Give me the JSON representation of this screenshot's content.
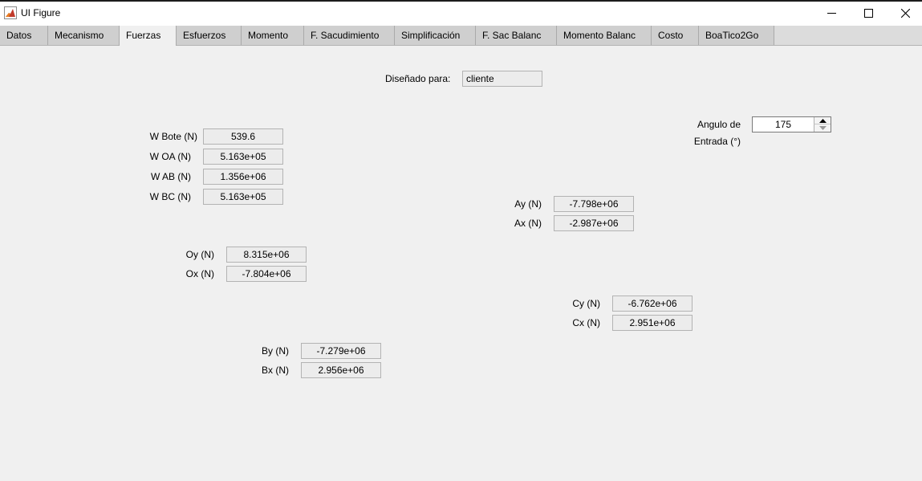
{
  "window": {
    "title": "UI Figure",
    "icon": "matlab-icon",
    "controls": [
      "minimize-icon",
      "maximize-icon",
      "close-icon"
    ]
  },
  "tabs": [
    {
      "label": "Datos"
    },
    {
      "label": "Mecanismo"
    },
    {
      "label": "Fuerzas",
      "active": true
    },
    {
      "label": "Esfuerzos"
    },
    {
      "label": "Momento"
    },
    {
      "label": "F. Sacudimiento"
    },
    {
      "label": "Simplificación"
    },
    {
      "label": "F. Sac Balanc"
    },
    {
      "label": "Momento Balanc"
    },
    {
      "label": "Costo"
    },
    {
      "label": "BoaTico2Go"
    }
  ],
  "designed_for": {
    "label": "Diseñado para:",
    "value": "cliente"
  },
  "entry_angle": {
    "label_line1": "Angulo de",
    "label_line2": "Entrada (°)",
    "value": "175"
  },
  "weights": {
    "w_bote": {
      "label": "W Bote (N)",
      "value": "539.6"
    },
    "w_oa": {
      "label": "W OA (N)",
      "value": "5.163e+05"
    },
    "w_ab": {
      "label": "W AB (N)",
      "value": "1.356e+06"
    },
    "w_bc": {
      "label": "W BC (N)",
      "value": "5.163e+05"
    }
  },
  "forces": {
    "ay": {
      "label": "Ay (N)",
      "value": "-7.798e+06"
    },
    "ax": {
      "label": "Ax (N)",
      "value": "-2.987e+06"
    },
    "oy": {
      "label": "Oy (N)",
      "value": "8.315e+06"
    },
    "ox": {
      "label": "Ox (N)",
      "value": "-7.804e+06"
    },
    "cy": {
      "label": "Cy (N)",
      "value": "-6.762e+06"
    },
    "cx": {
      "label": "Cx (N)",
      "value": "2.951e+06"
    },
    "by": {
      "label": "By (N)",
      "value": "-7.279e+06"
    },
    "bx": {
      "label": "Bx (N)",
      "value": "2.956e+06"
    }
  }
}
